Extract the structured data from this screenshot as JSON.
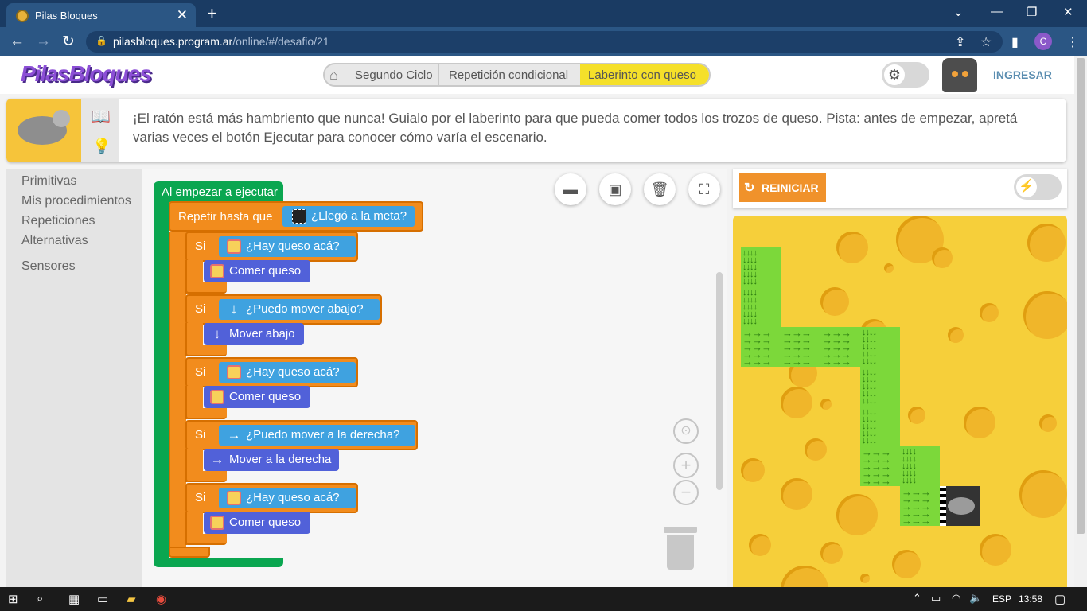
{
  "browser": {
    "tab_title": "Pilas Bloques",
    "url_host": "pilasbloques.program.ar",
    "url_path": "/online/#/desafio/21",
    "profile_initial": "C"
  },
  "header": {
    "logo": "PilasBloques",
    "breadcrumbs": [
      "Segundo Ciclo",
      "Repetición condicional",
      "Laberinto con queso"
    ],
    "login_label": "INGRESAR"
  },
  "description": "¡El ratón está más hambriento que nunca! Guialo por el laberinto para que pueda comer todos los trozos de queso. Pista: antes de empezar, apretá varias veces el botón Ejecutar para conocer cómo varía el escenario.",
  "toolbox": {
    "categories": [
      "Primitivas",
      "Mis procedimientos",
      "Repeticiones",
      "Alternativas",
      "Sensores"
    ]
  },
  "blocks": {
    "root": "Al empezar a ejecutar",
    "repeat_label": "Repetir hasta que",
    "repeat_condition": "¿Llegó a la meta?",
    "if_label": "Si",
    "ifs": [
      {
        "condition": "¿Hay queso acá?",
        "action": "Comer queso",
        "icon": "cheese-icon"
      },
      {
        "condition": "¿Puedo mover abajo?",
        "action": "Mover abajo",
        "icon": "arrow-down-icon"
      },
      {
        "condition": "¿Hay queso acá?",
        "action": "Comer queso",
        "icon": "cheese-icon"
      },
      {
        "condition": "¿Puedo mover a la derecha?",
        "action": "Mover a la derecha",
        "icon": "arrow-right-icon"
      },
      {
        "condition": "¿Hay queso acá?",
        "action": "Comer queso",
        "icon": "cheese-icon"
      }
    ]
  },
  "stage": {
    "reset_label": "REINICIAR"
  },
  "taskbar": {
    "language": "ESP",
    "time": "13:58"
  },
  "colors": {
    "event_block": "#0aa650",
    "control_block": "#f28c1d",
    "sensor_block": "#3fa2e0",
    "action_block": "#5161d9",
    "stage_bg": "#f6cf3a",
    "path_cell": "#7cd83a"
  }
}
